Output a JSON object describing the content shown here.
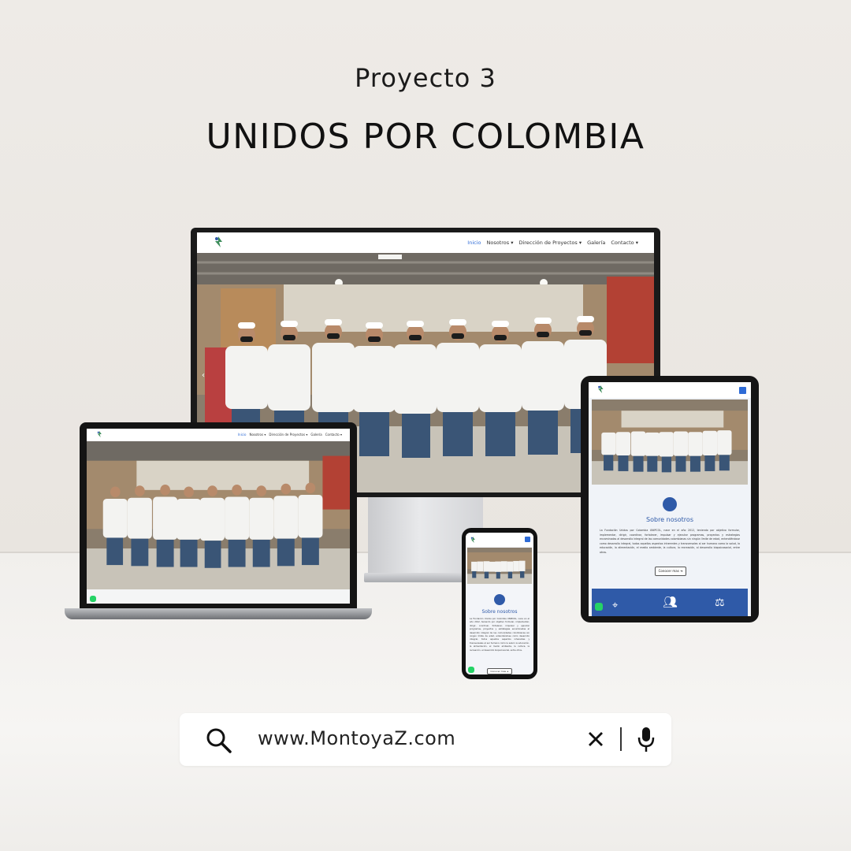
{
  "header": {
    "kicker": "Proyecto 3",
    "title": "UNIDOS POR COLOMBIA"
  },
  "site": {
    "nav": {
      "items": [
        "Inicio",
        "Nosotros ▾",
        "Dirección de Proyectos ▾",
        "Galería",
        "Contacto ▾"
      ],
      "active": "Inicio"
    },
    "about": {
      "title": "Sobre nosotros",
      "text": "La Fundación Unidos por Colombia UNIPCOL, nace en el año 2012, teniendo por objetivo formular, implementar, dirigir, coordinar, fortalecer, impulsar y ejecutar programas, proyectos y estrategias encaminadas al desarrollo integral de las comunidades colombianas sin ningún límite de edad, entendiéndose como desarrollo integral, todos aquellos aspectos inherentes y transversales al ser humano como la salud, la educación, la alimentación, el medio ambiente, la cultura, la recreación, al desarrollo biopsicosocial, entre otros.",
      "button": "Conocer mas ➜"
    }
  },
  "search": {
    "query": "www.MontoyaZ.com",
    "icons": [
      "search-icon",
      "clear-icon",
      "microphone-icon"
    ]
  },
  "colors": {
    "brand_blue": "#2f5aa8",
    "active_link": "#2e6bd6",
    "whatsapp": "#25d366"
  }
}
